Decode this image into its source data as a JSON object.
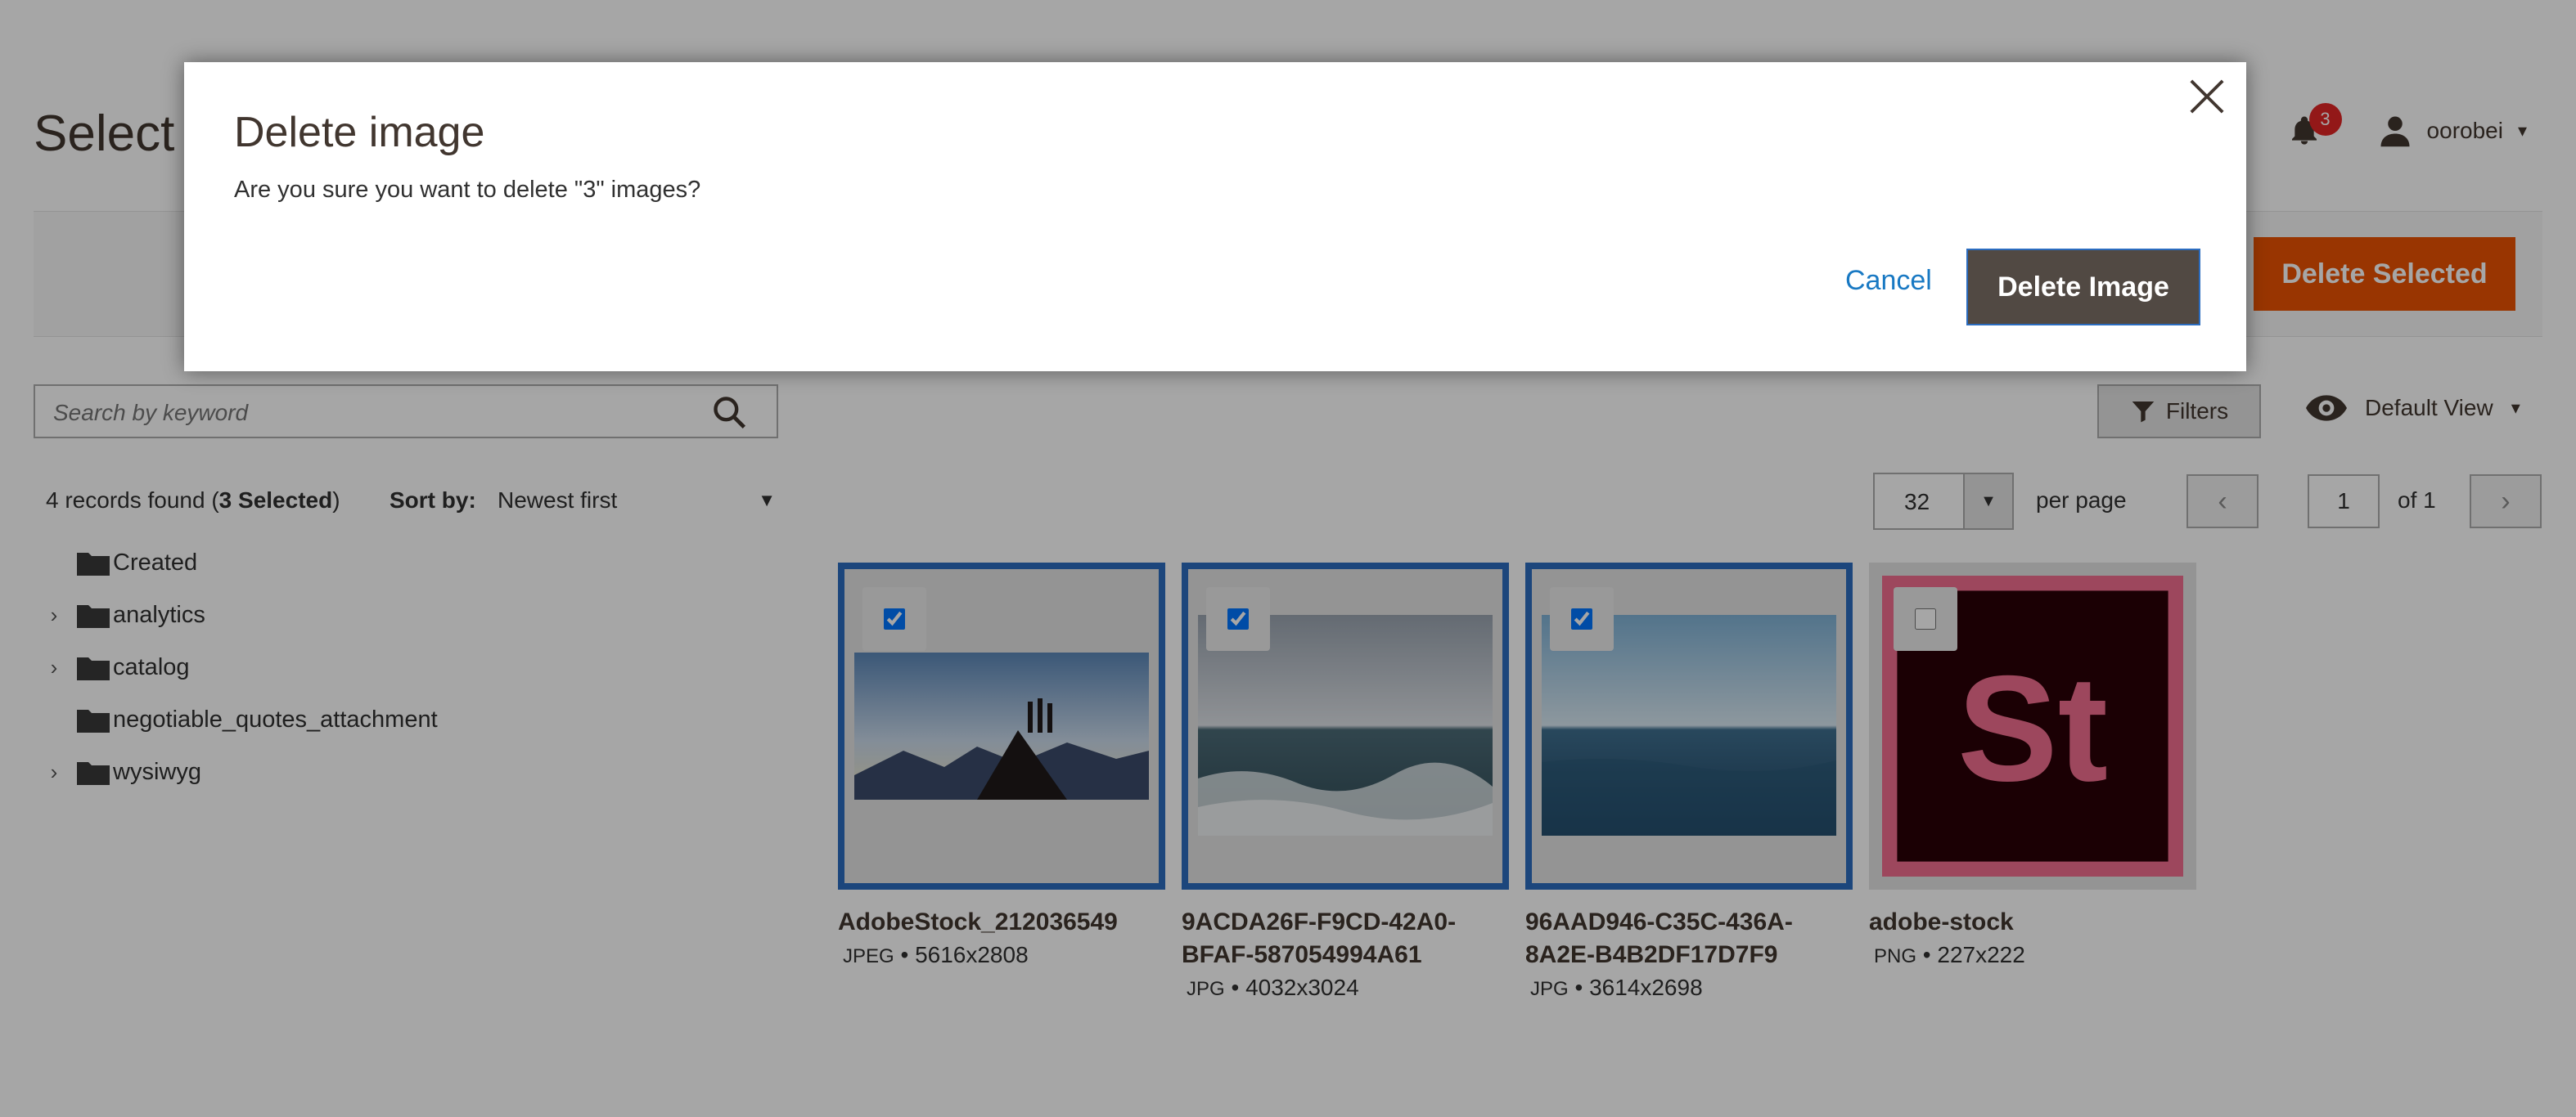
{
  "header": {
    "page_title": "Select Images",
    "notification_count": "3",
    "user_name": "oorobei"
  },
  "actions": {
    "delete_selected_label": "Delete Selected"
  },
  "search": {
    "placeholder": "Search by keyword"
  },
  "toolbar": {
    "filters_label": "Filters",
    "view_label": "Default View",
    "records_prefix": "4 records found (",
    "selected_count": "3 Selected",
    "records_suffix": ")",
    "sort_label": "Sort by:",
    "sort_value": "Newest first",
    "per_page_value": "32",
    "per_page_label": "per page",
    "current_page": "1",
    "page_total": "of 1"
  },
  "folders": [
    {
      "label": "Created",
      "expandable": false
    },
    {
      "label": "analytics",
      "expandable": true
    },
    {
      "label": "catalog",
      "expandable": true
    },
    {
      "label": "negotiable_quotes_attachment",
      "expandable": false
    },
    {
      "label": "wysiwyg",
      "expandable": true
    }
  ],
  "images": [
    {
      "title": "AdobeStock_212036549",
      "format": "JPEG",
      "size": "5616x2808",
      "selected": true
    },
    {
      "title": "9ACDA26F-F9CD-42A0-BFAF-587054994A61",
      "format": "JPG",
      "size": "4032x3024",
      "selected": true
    },
    {
      "title": "96AAD946-C35C-436A-8A2E-B4B2DF17D7F9",
      "format": "JPG",
      "size": "3614x2698",
      "selected": true
    },
    {
      "title": "adobe-stock",
      "format": "PNG",
      "size": "227x222",
      "selected": false
    }
  ],
  "modal": {
    "title": "Delete image",
    "message": "Are you sure you want to delete \"3\" images?",
    "cancel_label": "Cancel",
    "confirm_label": "Delete Image"
  },
  "colors": {
    "accent_orange": "#eb5202",
    "selection_blue": "#2b6cbf",
    "link_blue": "#1979c3",
    "confirm_bg": "#514943"
  },
  "icons": {
    "bell": "bell-icon",
    "user": "user-icon",
    "search": "search-icon",
    "filter": "filter-icon",
    "eye": "eye-icon",
    "folder": "folder-icon",
    "close": "close-icon"
  }
}
